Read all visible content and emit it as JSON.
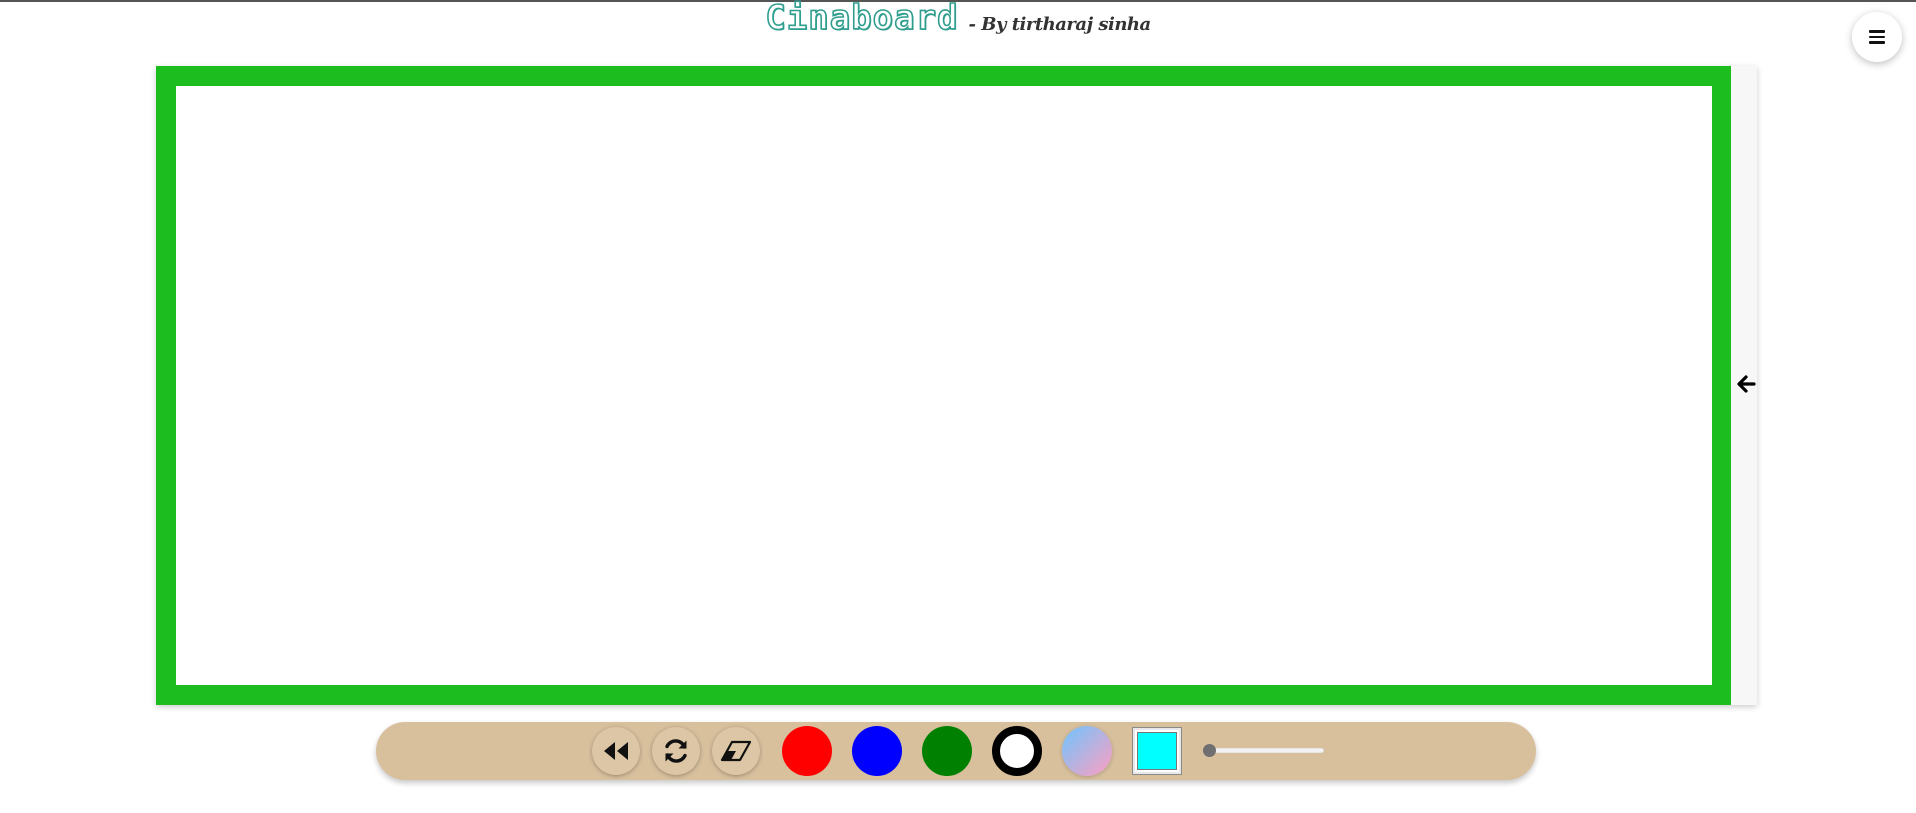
{
  "header": {
    "brand": "Cinaboard",
    "byline": "- By tirtharaj sinha"
  },
  "menu": {
    "icon": "hamburger-menu-icon"
  },
  "board": {
    "frame_color": "#1cbd1e",
    "canvas_color": "#ffffff",
    "side_toggle_icon": "arrow-left-icon"
  },
  "toolbar": {
    "background": "#d8c09d",
    "tools": [
      {
        "name": "undo",
        "icon": "backward-icon"
      },
      {
        "name": "clear",
        "icon": "refresh-icon"
      },
      {
        "name": "eraser",
        "icon": "eraser-icon"
      }
    ],
    "colors": [
      {
        "name": "red",
        "value": "#ff0000"
      },
      {
        "name": "blue",
        "value": "#0000ff"
      },
      {
        "name": "green",
        "value": "#008000"
      },
      {
        "name": "white",
        "value": "#ffffff"
      },
      {
        "name": "gradient",
        "value": "linear-gradient(#6ec5ff, #ff9ec0)"
      }
    ],
    "custom_color": "#00ffff",
    "brush_size_level": 0
  }
}
